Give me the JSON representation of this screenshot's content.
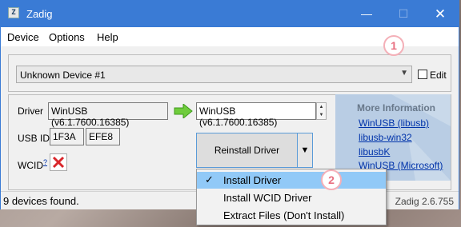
{
  "window": {
    "title": "Zadig"
  },
  "titlebar": {
    "minimize_icon": "minimize-icon",
    "maximize_icon": "maximize-icon",
    "close_icon": "close-icon",
    "app_icon_letter": "Z"
  },
  "menu": {
    "items": [
      "Device",
      "Options",
      "Help"
    ]
  },
  "device_select": {
    "value": "Unknown Device #1",
    "edit_label": "Edit",
    "edit_checked": false
  },
  "driver": {
    "label": "Driver",
    "current": "WinUSB (v6.1.7600.16385)",
    "target": "WinUSB (v6.1.7600.16385)"
  },
  "usb_id": {
    "label": "USB ID",
    "vid": "1F3A",
    "pid": "EFE8"
  },
  "wcid": {
    "label": "WCID",
    "superscript": "?",
    "status_icon": "red-x-icon"
  },
  "reinstall_button": {
    "label": "Reinstall Driver"
  },
  "more_info": {
    "title": "More Information",
    "links": [
      "WinUSB (libusb)",
      "libusb-win32",
      "libusbK",
      "WinUSB (Microsoft)"
    ]
  },
  "status": {
    "text": "9 devices found.",
    "version": "Zadig 2.6.755"
  },
  "dropdown_menu": {
    "items": [
      {
        "label": "Install Driver",
        "checked": true,
        "selected": true
      },
      {
        "label": "Install WCID Driver",
        "checked": false
      },
      {
        "label": "Extract Files (Don't Install)",
        "checked": false
      }
    ]
  },
  "annotations": {
    "badge1": "1",
    "badge2": "2",
    "badge_color": "#e86f80"
  },
  "colors": {
    "titlebar": "#3a7bd5",
    "arrow": "#6fcc3c",
    "panel": "#b9cde4",
    "link": "#0033aa"
  }
}
